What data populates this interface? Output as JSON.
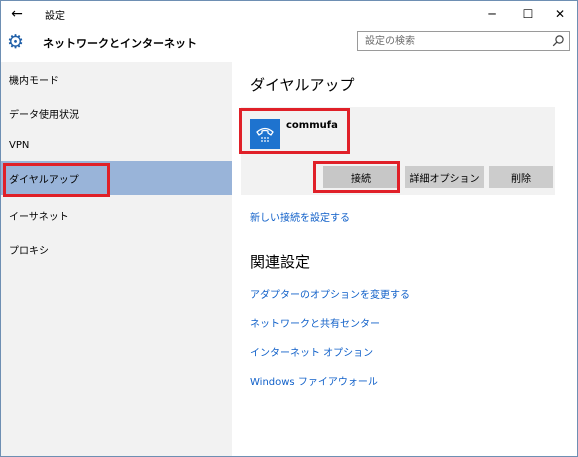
{
  "window": {
    "title": "設定",
    "back_icon": "←",
    "minimize_icon": "─",
    "maximize_icon": "☐",
    "close_icon": "✕"
  },
  "header": {
    "title": "ネットワークとインターネット",
    "icon": "gear-icon",
    "search_placeholder": "設定の検索"
  },
  "sidebar": {
    "items": [
      {
        "label": "機内モード",
        "selected": false
      },
      {
        "label": "データ使用状況",
        "selected": false
      },
      {
        "label": "VPN",
        "selected": false
      },
      {
        "label": "ダイヤルアップ",
        "selected": true
      },
      {
        "label": "イーサネット",
        "selected": false
      },
      {
        "label": "プロキシ",
        "selected": false
      }
    ]
  },
  "main": {
    "section_title": "ダイヤルアップ",
    "connection": {
      "name": "commufa",
      "icon": "phone-icon",
      "buttons": {
        "connect": "接続",
        "advanced": "詳細オプション",
        "delete": "削除"
      }
    },
    "new_connection_link": "新しい接続を設定する",
    "related": {
      "title": "関連設定",
      "links": [
        "アダプターのオプションを変更する",
        "ネットワークと共有センター",
        "インターネット オプション",
        "Windows ファイアウォール"
      ]
    }
  },
  "colors": {
    "accent": "#1e73cf",
    "link": "#1060c9",
    "selected_bg": "#99b4d9",
    "sidebar_bg": "#f2f2f2",
    "highlight": "#e02028"
  }
}
